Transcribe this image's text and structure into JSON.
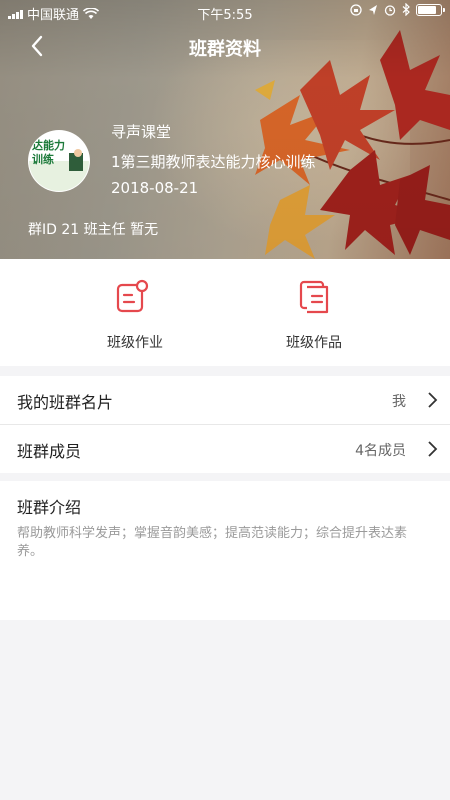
{
  "status_bar": {
    "carrier": "中国联通",
    "time": "下午5:55",
    "icons": [
      "signal-icon",
      "wifi-icon",
      "lock-rotation-icon",
      "location-icon",
      "alarm-icon",
      "bluetooth-icon",
      "battery-icon"
    ]
  },
  "nav": {
    "title": "班群资料",
    "back_icon": "chevron-left-icon"
  },
  "profile": {
    "name": "寻声课堂",
    "course": "1第三期教师表达能力核心训练",
    "date": "2018-08-21",
    "meta": "群ID 21 班主任 暂无",
    "avatar_text": [
      "达能力",
      "训练"
    ]
  },
  "actions": [
    {
      "label": "班级作业",
      "icon": "homework-icon"
    },
    {
      "label": "班级作品",
      "icon": "works-icon"
    }
  ],
  "rows": [
    {
      "label": "我的班群名片",
      "value": "我"
    },
    {
      "label": "班群成员",
      "value": "4名成员"
    }
  ],
  "intro": {
    "title": "班群介绍",
    "text": "帮助教师科学发声；掌握音韵美感；提高范读能力；综合提升表达素养。"
  },
  "colors": {
    "accent": "#e5484d",
    "background": "#f4f4f6"
  }
}
